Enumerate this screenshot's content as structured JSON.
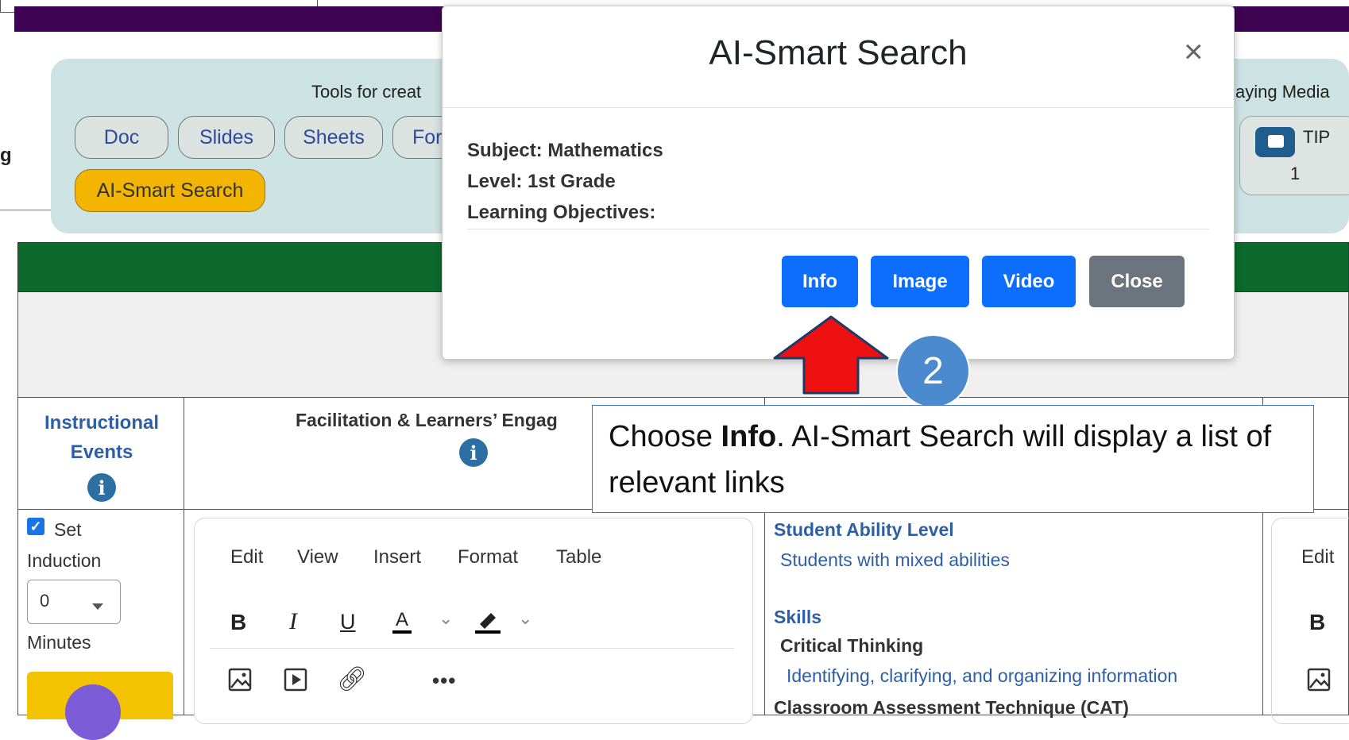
{
  "page": {
    "left_edge_text": "g",
    "tools": {
      "caption": "Tools for creat",
      "buttons": [
        "Doc",
        "Slides",
        "Sheets",
        "For"
      ],
      "ai_search_label": "AI-Smart Search",
      "media_caption": "aying Media",
      "tip_label": "TIP",
      "tip_count": "1"
    },
    "table": {
      "col1_header": "Instructional Events",
      "col2_header": "Facilitation & Learners’ Engag",
      "row1": {
        "set_label": "Set",
        "induction_label": "Induction",
        "minutes_value": "0",
        "minutes_label": "Minutes"
      },
      "editor": {
        "menu": [
          "Edit",
          "View",
          "Insert",
          "Format",
          "Table"
        ],
        "bold": "B",
        "italic": "I",
        "underline": "U",
        "text_color": "A",
        "more": "•••"
      },
      "right_col": {
        "ability_title": "Student Ability Level",
        "ability_value": "Students with mixed abilities",
        "skills_title": "Skills",
        "skill_name": "Critical Thinking",
        "skill_desc": "Identifying, clarifying, and organizing information",
        "cat_title": "Classroom Assessment Technique (CAT)"
      },
      "far_right": {
        "edit": "Edit",
        "bold": "B"
      }
    }
  },
  "modal": {
    "title": "AI-Smart Search",
    "close_symbol": "×",
    "subject": "Subject: Mathematics",
    "level": "Level: 1st Grade",
    "objectives": "Learning Objectives:",
    "buttons": {
      "info": "Info",
      "image": "Image",
      "video": "Video",
      "close": "Close"
    }
  },
  "annotation": {
    "step_number": "2",
    "callout_prefix": "Choose ",
    "callout_bold": "Info",
    "callout_rest": ". AI-Smart Search will display a list of relevant links"
  },
  "colors": {
    "top_bar": "#3e0452",
    "green_bar": "#0b6a2c",
    "primary_button": "#0d6efd",
    "secondary_button": "#6c757d",
    "ai_pill": "#f3b500",
    "arrow_red": "#ee1111",
    "step_circle": "#4c8ad0"
  }
}
